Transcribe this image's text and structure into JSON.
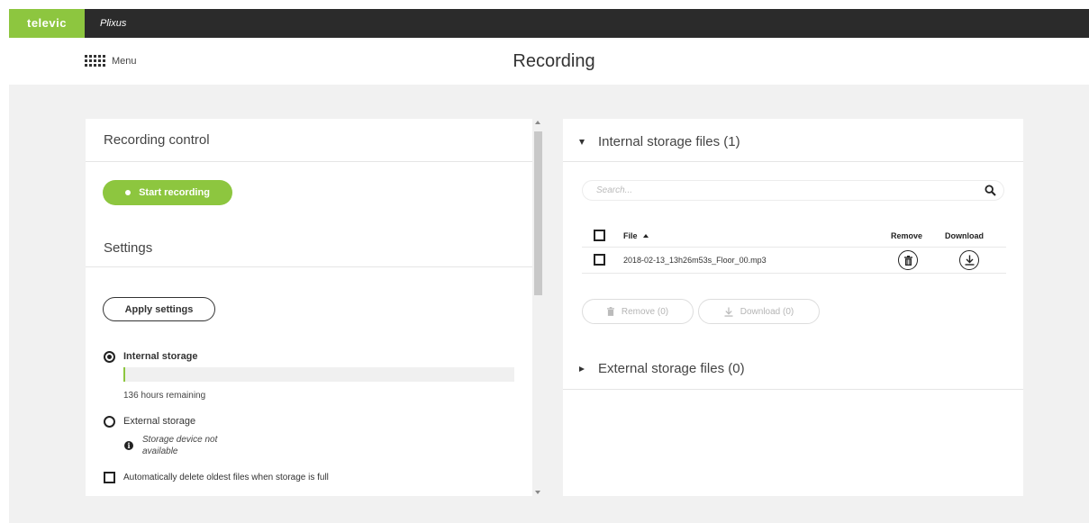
{
  "brand": {
    "logo_text": "televic",
    "app_name": "Plixus"
  },
  "header": {
    "menu_label": "Menu",
    "page_title": "Recording"
  },
  "recording_control": {
    "title": "Recording control",
    "start_button_label": "Start recording"
  },
  "settings": {
    "title": "Settings",
    "apply_button_label": "Apply settings",
    "internal_storage_label": "Internal storage",
    "internal_storage_selected": true,
    "internal_storage_used_fraction": 0.005,
    "remaining_text": "136 hours remaining",
    "external_storage_label": "External storage",
    "external_storage_selected": false,
    "external_info_text": "Storage device not available",
    "auto_delete_label": "Automatically delete oldest files when storage is full",
    "auto_delete_checked": false
  },
  "internal_files": {
    "title": "Internal storage files (1)",
    "expanded": true,
    "search_placeholder": "Search...",
    "columns": {
      "file": "File",
      "remove": "Remove",
      "download": "Download"
    },
    "rows": [
      {
        "file": "2018-02-13_13h26m53s_Floor_00.mp3",
        "checked": false
      }
    ],
    "remove_selected_label": "Remove (0)",
    "download_selected_label": "Download (0)"
  },
  "external_files": {
    "title": "External storage files (0)",
    "expanded": false
  },
  "colors": {
    "accent": "#8dc63f",
    "topbar": "#2b2b2b",
    "background": "#f1f1f1"
  }
}
